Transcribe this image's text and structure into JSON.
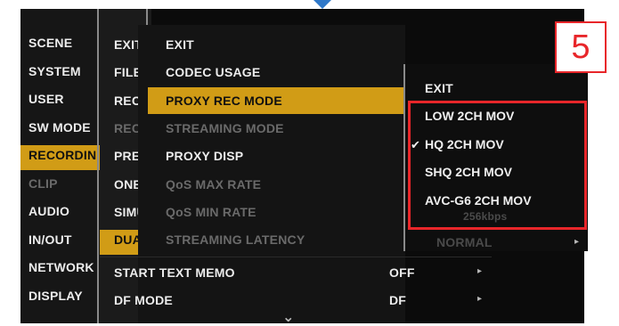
{
  "menu_level1": [
    {
      "label": "SCENE",
      "state": "normal"
    },
    {
      "label": "SYSTEM",
      "state": "normal"
    },
    {
      "label": "USER",
      "state": "normal"
    },
    {
      "label": "SW MODE",
      "state": "normal"
    },
    {
      "label": "RECORDING",
      "state": "selected"
    },
    {
      "label": "CLIP",
      "state": "disabled"
    },
    {
      "label": "AUDIO",
      "state": "normal"
    },
    {
      "label": "IN/OUT",
      "state": "normal"
    },
    {
      "label": "NETWORK",
      "state": "normal"
    },
    {
      "label": "DISPLAY",
      "state": "normal"
    }
  ],
  "menu_level2": [
    {
      "label": "EXIT",
      "state": "normal"
    },
    {
      "label": "FILE",
      "state": "normal"
    },
    {
      "label": "REC",
      "state": "normal"
    },
    {
      "label": "REC",
      "state": "disabled"
    },
    {
      "label": "PRE",
      "state": "normal"
    },
    {
      "label": "ONE",
      "state": "normal"
    },
    {
      "label": "SIMU",
      "state": "normal"
    },
    {
      "label": "DUAL",
      "state": "selected"
    }
  ],
  "menu_level3": [
    {
      "label": "EXIT",
      "state": "normal"
    },
    {
      "label": "CODEC USAGE",
      "state": "normal"
    },
    {
      "label": "PROXY REC MODE",
      "state": "selected"
    },
    {
      "label": "STREAMING MODE",
      "state": "disabled"
    },
    {
      "label": "PROXY DISP",
      "state": "normal"
    },
    {
      "label": "QoS MAX RATE",
      "state": "disabled"
    },
    {
      "label": "QoS MIN RATE",
      "state": "disabled"
    },
    {
      "label": "STREAMING LATENCY",
      "state": "disabled"
    }
  ],
  "menu_bottom": [
    {
      "label": "START TEXT MEMO",
      "value": "OFF"
    },
    {
      "label": "DF MODE",
      "value": "DF"
    }
  ],
  "submenu": {
    "exit_label": "EXIT",
    "options": [
      {
        "label": "LOW 2CH MOV",
        "checked": false
      },
      {
        "label": "HQ 2CH MOV",
        "checked": true
      },
      {
        "label": "SHQ 2CH MOV",
        "checked": false
      },
      {
        "label": "AVC-G6 2CH MOV",
        "checked": false
      }
    ],
    "check_glyph": "✔",
    "hidden_value_1": "256kbps",
    "hidden_value_2": "NORMAL"
  },
  "glyphs": {
    "right_arrow": "▸",
    "down_chevron": "⌄"
  },
  "callout": {
    "step_number": "5"
  },
  "colors": {
    "highlight": "#d19c16",
    "callout_red": "#e8262a",
    "pointer_blue": "#2f78c8"
  }
}
